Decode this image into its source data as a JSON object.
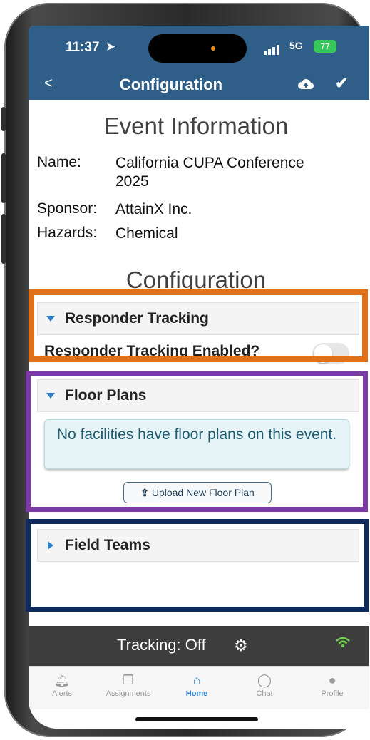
{
  "status": {
    "time": "11:37",
    "network": "5G",
    "battery": "77"
  },
  "nav": {
    "back": "<",
    "title": "Configuration"
  },
  "event": {
    "heading": "Event Information",
    "name_label": "Name:",
    "name_value": "California CUPA Conference 2025",
    "sponsor_label": "Sponsor:",
    "sponsor_value": "AttainX Inc.",
    "hazards_label": "Hazards:",
    "hazards_value": "Chemical"
  },
  "config": {
    "heading": "Configuration",
    "responder": {
      "title": "Responder Tracking",
      "enabled_label": "Responder Tracking Enabled?",
      "enabled": false
    },
    "floor_plans": {
      "title": "Floor Plans",
      "notice": "No facilities have floor plans on this event.",
      "upload_label": "Upload New Floor Plan"
    },
    "field_teams": {
      "title": "Field Teams"
    }
  },
  "tracking": {
    "label": "Tracking:",
    "value": "Off"
  },
  "tabs": [
    {
      "label": "Alerts",
      "icon": "bell-icon"
    },
    {
      "label": "Assignments",
      "icon": "clipboard-icon"
    },
    {
      "label": "Home",
      "icon": "home-icon"
    },
    {
      "label": "Chat",
      "icon": "chat-icon"
    },
    {
      "label": "Profile",
      "icon": "person-icon"
    }
  ],
  "colors": {
    "header": "#2f5f88",
    "accent": "#2d7fc9",
    "highlight_responder": "#e0701a",
    "highlight_floor_plans": "#7b3aa6",
    "highlight_field_teams": "#0f2a5c"
  }
}
